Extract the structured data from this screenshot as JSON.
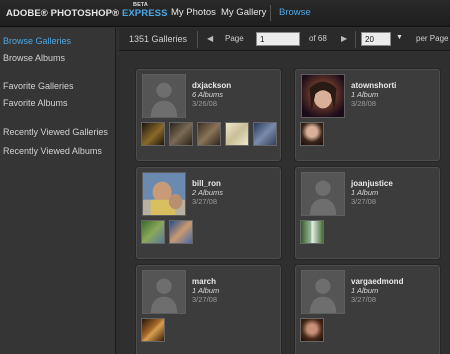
{
  "brand": {
    "name": "ADOBE® PHOTOSHOP®",
    "express": "EXPRESS",
    "beta": "BETA"
  },
  "nav": {
    "my_photos": "My Photos",
    "my_gallery": "My Gallery",
    "browse": "Browse"
  },
  "sidebar": {
    "items": [
      {
        "label": "Browse Galleries",
        "active": true
      },
      {
        "label": "Browse Albums",
        "active": false
      },
      {
        "label": "Favorite Galleries",
        "active": false
      },
      {
        "label": "Favorite Albums",
        "active": false
      },
      {
        "label": "Recently Viewed Galleries",
        "active": false
      },
      {
        "label": "Recently Viewed Albums",
        "active": false
      }
    ]
  },
  "header": {
    "galleries_count": "1351 Galleries",
    "page_label": "Page",
    "page_value": "1",
    "of_pages": "of 68",
    "per_page_value": "20",
    "per_page_label": "per Page",
    "prev_icon": "arrow-left-icon",
    "next_icon": "arrow-right-icon"
  },
  "galleries": [
    {
      "name": "dxjackson",
      "albums": "6 Albums",
      "date": "3/26/08",
      "avatar": "placeholder",
      "thumb_colors": [
        "#6a5a2e",
        "#3a3225",
        "#5b4a38",
        "#cfc8a8",
        "#4b5a7a"
      ]
    },
    {
      "name": "atownshorti",
      "albums": "1 Album",
      "date": "3/28/08",
      "avatar": "photo-girl",
      "thumb_colors": [
        "#8a6a5a"
      ]
    },
    {
      "name": "bill_ron",
      "albums": "2 Albums",
      "date": "3/27/08",
      "avatar": "photo-man",
      "thumb_colors": [
        "#5a7a3a",
        "#3a5a8a"
      ]
    },
    {
      "name": "joanjustice",
      "albums": "1 Album",
      "date": "3/27/08",
      "avatar": "placeholder",
      "thumb_colors": [
        "#4a6a4a"
      ]
    },
    {
      "name": "march",
      "albums": "1 Album",
      "date": "3/27/08",
      "avatar": "placeholder",
      "thumb_colors": [
        "#7a4a2a"
      ]
    },
    {
      "name": "vargaedmond",
      "albums": "1 Album",
      "date": "3/27/08",
      "avatar": "placeholder",
      "thumb_colors": [
        "#6a4a3a"
      ]
    }
  ],
  "colors": {
    "accent": "#4aa8e8",
    "background": "#2f2f2f",
    "card": "#3c3c3c"
  }
}
